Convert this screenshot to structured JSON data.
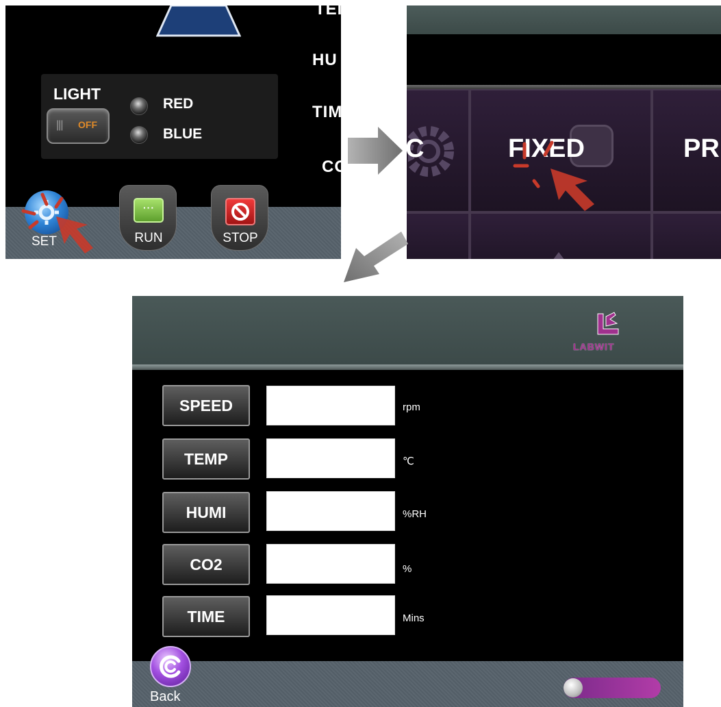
{
  "main_screen": {
    "side_labels": [
      "TEI",
      "HU",
      "TIM",
      "CO"
    ],
    "light": {
      "label": "LIGHT",
      "switch_state": "OFF",
      "leds": [
        {
          "label": "RED"
        },
        {
          "label": "BLUE"
        }
      ]
    },
    "toolbar": {
      "set_label": "SET",
      "run_label": "RUN",
      "run_icon_text": "···",
      "stop_label": "STOP"
    }
  },
  "menu_screen": {
    "items": [
      {
        "label": "C"
      },
      {
        "label": "FIXED"
      },
      {
        "label": "PR"
      }
    ]
  },
  "fixed_screen": {
    "logo": "LABWIT",
    "params": [
      {
        "label": "SPEED",
        "value": "",
        "unit": "rpm"
      },
      {
        "label": "TEMP",
        "value": "",
        "unit": "℃"
      },
      {
        "label": "HUMI",
        "value": "",
        "unit": "%RH"
      },
      {
        "label": "CO2",
        "value": "",
        "unit": "%"
      },
      {
        "label": "TIME",
        "value": "",
        "unit": "Mins"
      }
    ],
    "back_label": "Back"
  },
  "colors": {
    "pointer_red": "#c83a2a",
    "logo_magenta": "#a0318e",
    "arrow_gray": "#8a8a8a"
  }
}
